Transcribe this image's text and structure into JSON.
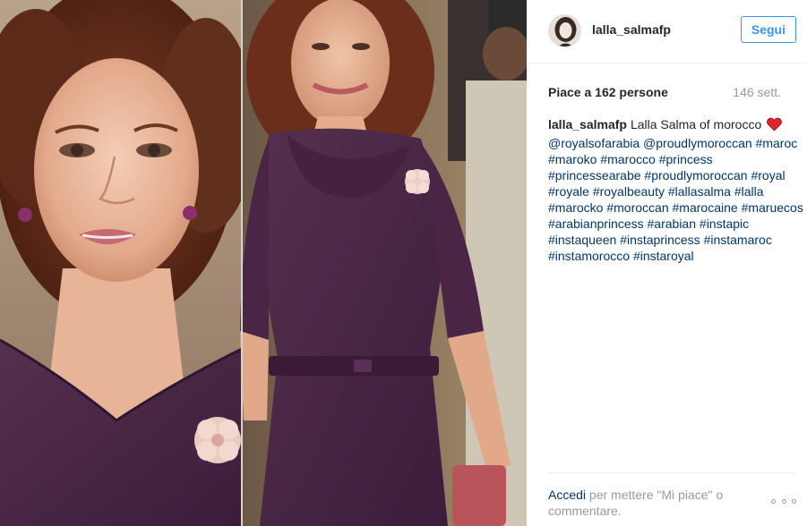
{
  "post": {
    "author": {
      "username": "lalla_salmafp"
    },
    "header": {
      "follow_label": "Segui"
    },
    "stats": {
      "likes_text": "Piace a 162 persone",
      "time_ago": "146 sett."
    },
    "caption": {
      "username": "lalla_salmafp",
      "text": "Lalla Salma of morocco",
      "emoji": "heart",
      "tags": [
        "@royalsofarabia",
        "@proudlymoroccan",
        "#maroc",
        "#maroko",
        "#marocco",
        "#princess",
        "#princessearabe",
        "#proudlymoroccan",
        "#royal",
        "#royale",
        "#royalbeauty",
        "#lallasalma",
        "#lalla",
        "#marocko",
        "#moroccan",
        "#marocaine",
        "#maruecos",
        "#arabianprincess",
        "#arabian",
        "#instapic",
        "#instaqueen",
        "#instaprincess",
        "#instamaroc",
        "#instamorocco",
        "#instaroyal"
      ]
    },
    "footer": {
      "login_link": "Accedi",
      "login_rest": " per mettere \"Mi piace\" o commentare."
    }
  },
  "colors": {
    "link_blue": "#003569",
    "button_blue": "#3897f0",
    "text_dark": "#262626",
    "text_grey": "#999999",
    "dress_purple": "#4a2448",
    "heart_red": "#e0252b"
  },
  "icons": {
    "more": "more-options-icon",
    "heart": "heart-icon"
  }
}
